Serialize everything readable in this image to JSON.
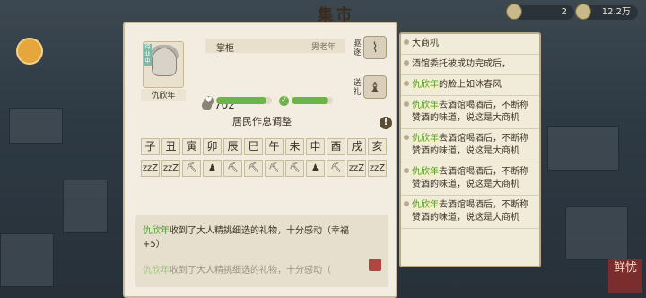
{
  "top": {
    "title": "集市",
    "resource_1": "2",
    "resource_2": "12.2万"
  },
  "seal_text": "鲜忧",
  "resident": {
    "tag": "待业中",
    "name": "仇欣年",
    "role": "掌柜",
    "meta": "男老年",
    "money": "702",
    "happiness_fraction": 0.9,
    "health_fraction": 0.9
  },
  "actions": {
    "expel_label": "驱逐",
    "gift_label": "送礼"
  },
  "schedule": {
    "title": "居民作息调整",
    "hours": [
      "子",
      "丑",
      "寅",
      "卯",
      "辰",
      "巳",
      "午",
      "未",
      "申",
      "酉",
      "戌",
      "亥"
    ],
    "activities": [
      "zzZ",
      "zzZ",
      "⛏",
      "♟",
      "⛏",
      "⛏",
      "⛏",
      "⛏",
      "♟",
      "⛏",
      "zzZ",
      "zzZ"
    ]
  },
  "bottom_log": {
    "line1_name": "仇欣年",
    "line1_rest": "收到了大人精挑细选的礼物，十分感动（幸福+5）",
    "line2_name": "仇欣年",
    "line2_rest": "收到了大人精挑细选的礼物，十分感动（"
  },
  "log_entries": [
    {
      "name": "",
      "text": "大商机"
    },
    {
      "name": "",
      "text": "酒馆委托被成功完成后，"
    },
    {
      "name": "仇欣年",
      "text": "的脸上如沐春风"
    },
    {
      "name": "仇欣年",
      "text": "去酒馆喝酒后，不断称赞酒的味道，说这是大商机"
    },
    {
      "name": "仇欣年",
      "text": "去酒馆喝酒后，不断称赞酒的味道，说这是大商机"
    },
    {
      "name": "仇欣年",
      "text": "去酒馆喝酒后，不断称赞酒的味道，说这是大商机"
    },
    {
      "name": "仇欣年",
      "text": "去酒馆喝酒后，不断称赞酒的味道，说这是大商机"
    }
  ]
}
